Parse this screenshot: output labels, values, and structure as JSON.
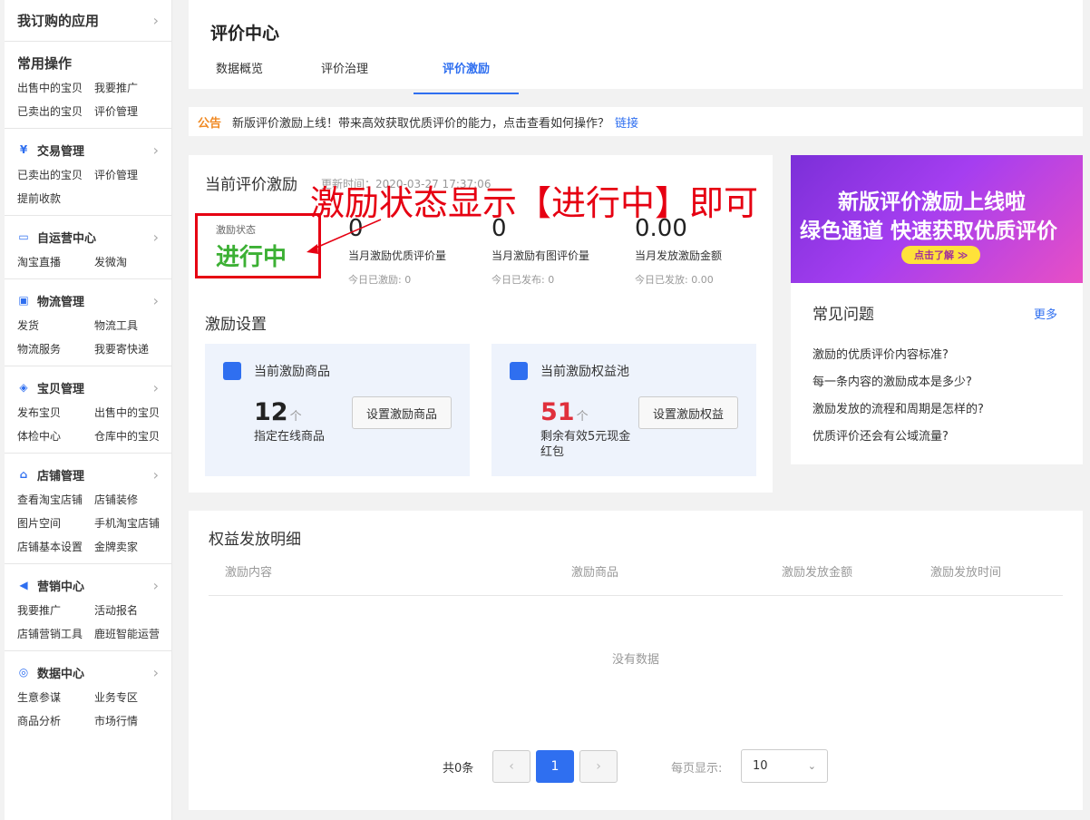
{
  "sidebar": {
    "top": "我订购的应用",
    "common": {
      "title": "常用操作",
      "links": [
        "出售中的宝贝",
        "我要推广",
        "已卖出的宝贝",
        "评价管理"
      ]
    },
    "sections": [
      {
        "title": "交易管理",
        "icon": "yen-icon",
        "links": [
          "已卖出的宝贝",
          "评价管理",
          "提前收款"
        ]
      },
      {
        "title": "自运营中心",
        "icon": "chat-icon",
        "links": [
          "淘宝直播",
          "发微淘"
        ]
      },
      {
        "title": "物流管理",
        "icon": "truck-icon",
        "links": [
          "发货",
          "物流工具",
          "物流服务",
          "我要寄快递"
        ]
      },
      {
        "title": "宝贝管理",
        "icon": "bag-icon",
        "links": [
          "发布宝贝",
          "出售中的宝贝",
          "体检中心",
          "仓库中的宝贝"
        ]
      },
      {
        "title": "店铺管理",
        "icon": "shop-icon",
        "links": [
          "查看淘宝店铺",
          "店铺装修",
          "图片空间",
          "手机淘宝店铺",
          "店铺基本设置",
          "金牌卖家"
        ]
      },
      {
        "title": "营销中心",
        "icon": "megaphone-icon",
        "links": [
          "我要推广",
          "活动报名",
          "店铺营销工具",
          "鹿班智能运营"
        ]
      },
      {
        "title": "数据中心",
        "icon": "compass-icon",
        "links": [
          "生意参谋",
          "业务专区",
          "商品分析",
          "市场行情"
        ]
      }
    ]
  },
  "header": {
    "title": "评价中心",
    "tabs": [
      "数据概览",
      "评价治理",
      "评价激励"
    ],
    "active_tab": "评价激励"
  },
  "notice": {
    "label": "公告",
    "text": "新版评价激励上线！带来高效获取优质评价的能力，点击查看如何操作？",
    "link": "链接"
  },
  "incentive": {
    "title": "当前评价激励",
    "updated": "更新时间：2020-03-27 17:37:06",
    "status_label": "激励状态",
    "status_value": "进行中",
    "stats": [
      {
        "value": "0",
        "label": "当月激励优质评价量",
        "sub": "今日已激励: 0"
      },
      {
        "value": "0",
        "label": "当月激励有图评价量",
        "sub": "今日已发布: 0"
      },
      {
        "value": "0.00",
        "label": "当月发放激励金额",
        "sub": "今日已发放: 0.00"
      }
    ],
    "settings_title": "激励设置",
    "goods": {
      "title": "当前激励商品",
      "count": "12",
      "unit": "个",
      "desc": "指定在线商品",
      "button": "设置激励商品"
    },
    "pool": {
      "title": "当前激励权益池",
      "count": "51",
      "unit": "个",
      "desc": "剩余有效5元现金红包",
      "button": "设置激励权益"
    }
  },
  "banner": {
    "line1": "新版评价激励上线啦",
    "line2": "绿色通道 快速获取优质评价",
    "cta": "点击了解 ≫"
  },
  "faq": {
    "title": "常见问题",
    "more": "更多",
    "items": [
      "激励的优质评价内容标准?",
      "每一条内容的激励成本是多少?",
      "激励发放的流程和周期是怎样的?",
      "优质评价还会有公域流量?"
    ]
  },
  "details": {
    "title": "权益发放明细",
    "columns": [
      "激励内容",
      "激励商品",
      "激励发放金额",
      "激励发放时间"
    ],
    "empty": "没有数据",
    "total": "共0条",
    "page": "1",
    "page_size_label": "每页显示:",
    "page_size": "10"
  },
  "annotation": {
    "text": "激励状态显示【进行中】即可",
    "color": "#e60012"
  }
}
